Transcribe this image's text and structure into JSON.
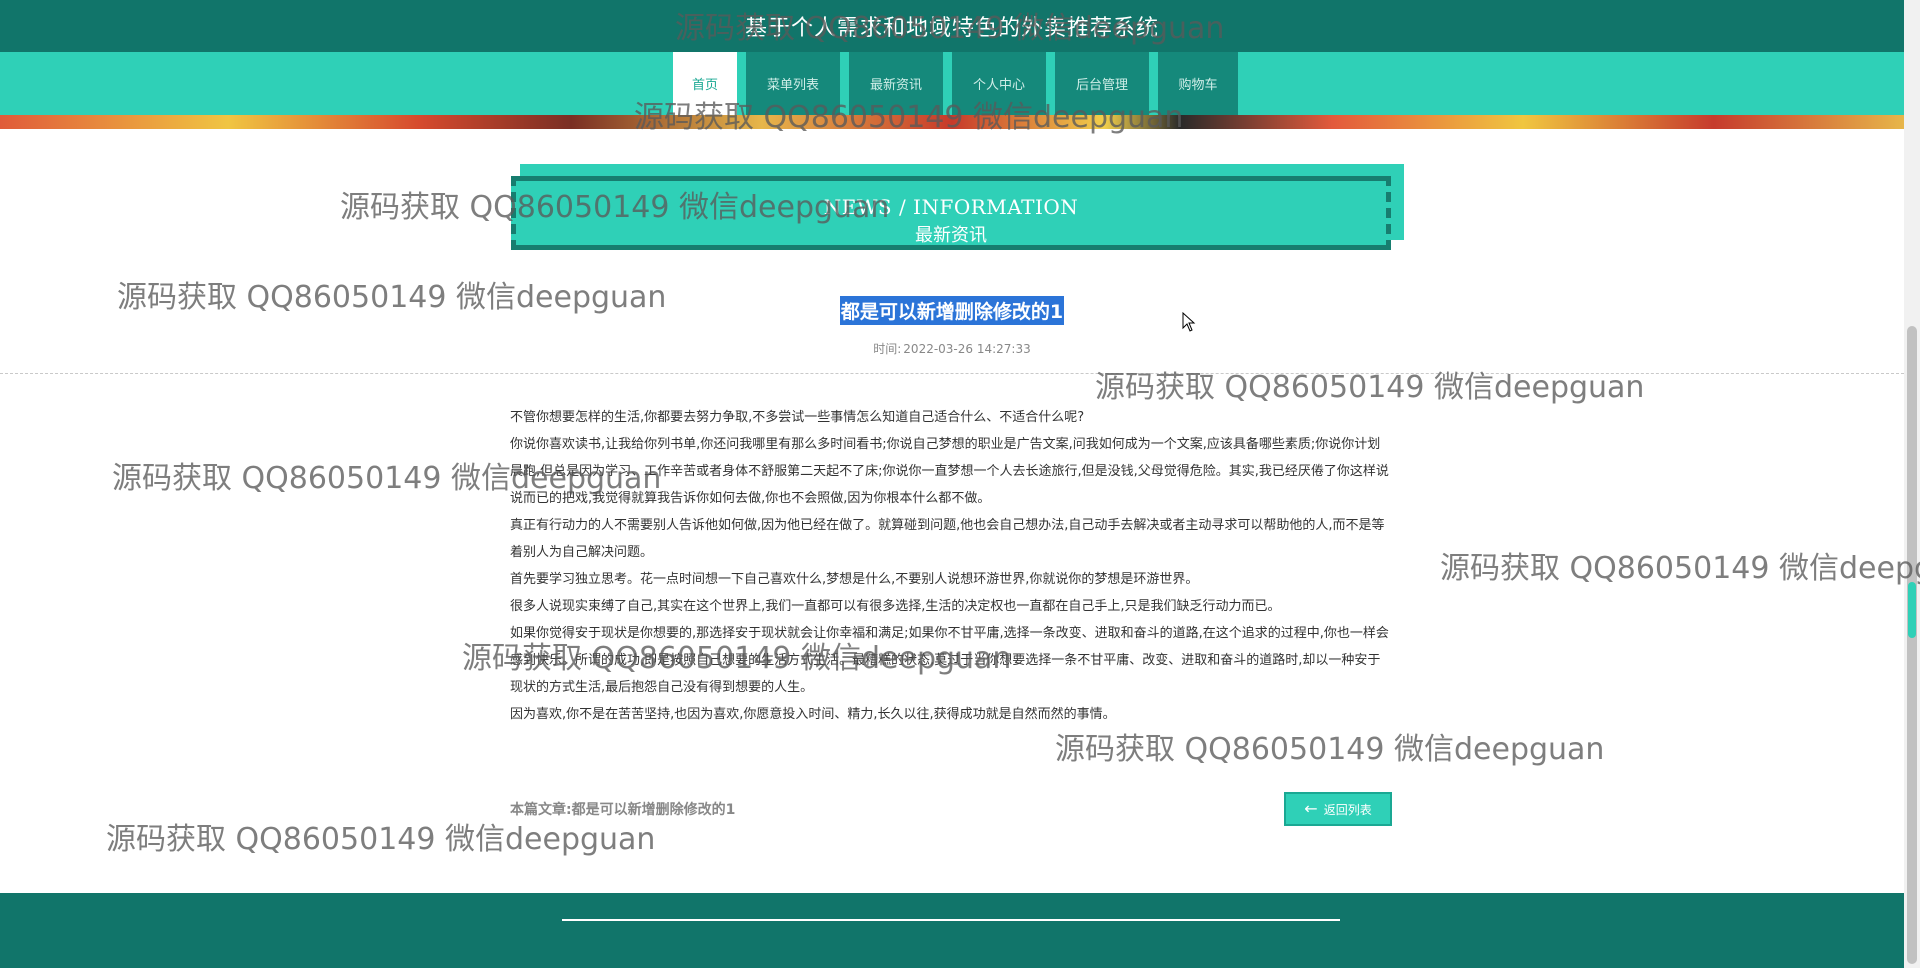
{
  "header": {
    "site_title": "基于个人需求和地域特色的外卖推荐系统"
  },
  "nav": [
    {
      "label": "首页",
      "active": true
    },
    {
      "label": "菜单列表",
      "active": false
    },
    {
      "label": "最新资讯",
      "active": false
    },
    {
      "label": "个人中心",
      "active": false
    },
    {
      "label": "后台管理",
      "active": false
    },
    {
      "label": "购物车",
      "active": false
    }
  ],
  "section": {
    "title_en": "NEWS / INFORMATION",
    "title_cn": "最新资讯"
  },
  "article": {
    "title": "都是可以新增删除修改的1",
    "time_label": "时间:",
    "time_value": "2022-03-26 14:27:33",
    "paragraphs": [
      "不管你想要怎样的生活,你都要去努力争取,不多尝试一些事情怎么知道自己适合什么、不适合什么呢?",
      "你说你喜欢读书,让我给你列书单,你还问我哪里有那么多时间看书;你说自己梦想的职业是广告文案,问我如何成为一个文案,应该具备哪些素质;你说你计划晨跑,但总是因为学习、工作辛苦或者身体不舒服第二天起不了床;你说你一直梦想一个人去长途旅行,但是没钱,父母觉得危险。其实,我已经厌倦了你这样说说而已的把戏,我觉得就算我告诉你如何去做,你也不会照做,因为你根本什么都不做。",
      "真正有行动力的人不需要别人告诉他如何做,因为他已经在做了。就算碰到问题,他也会自己想办法,自己动手去解决或者主动寻求可以帮助他的人,而不是等着别人为自己解决问题。",
      "首先要学习独立思考。花一点时间想一下自己喜欢什么,梦想是什么,不要别人说想环游世界,你就说你的梦想是环游世界。",
      "很多人说现实束缚了自己,其实在这个世界上,我们一直都可以有很多选择,生活的决定权也一直都在自己手上,只是我们缺乏行动力而已。",
      "如果你觉得安于现状是你想要的,那选择安于现状就会让你幸福和满足;如果你不甘平庸,选择一条改变、进取和奋斗的道路,在这个追求的过程中,你也一样会感到快乐。所谓的成功,即是按照自己想要的生活方式生活。最糟糕的状态,莫过于当你想要选择一条不甘平庸、改变、进取和奋斗的道路时,却以一种安于现状的方式生活,最后抱怨自己没有得到想要的人生。",
      "因为喜欢,你不是在苦苦坚持,也因为喜欢,你愿意投入时间、精力,长久以往,获得成功就是自然而然的事情。"
    ],
    "footer_label": "本篇文章:都是可以新增删除修改的1",
    "back_button": "返回列表"
  },
  "watermark_text": "源码获取 QQ86050149 微信deepguan",
  "colors": {
    "header_dark": "#11756a",
    "accent": "#2fd0b7",
    "selection": "#2b74d8"
  }
}
